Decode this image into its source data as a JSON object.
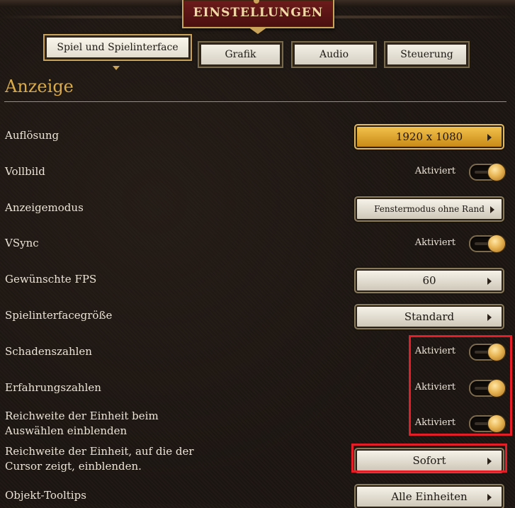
{
  "header": {
    "title": "EINSTELLUNGEN"
  },
  "tabs": [
    {
      "label": "Spiel und Spielinterface",
      "active": true
    },
    {
      "label": "Grafik"
    },
    {
      "label": "Audio"
    },
    {
      "label": "Steuerung"
    }
  ],
  "section": {
    "title": "Anzeige"
  },
  "rows": {
    "resolution": {
      "label": "Auflösung",
      "value": "1920 x 1080"
    },
    "fullscreen": {
      "label": "Vollbild",
      "status": "Aktiviert"
    },
    "display_mode": {
      "label": "Anzeigemodus",
      "value": "Fenstermodus ohne Rand"
    },
    "vsync": {
      "label": "VSync",
      "status": "Aktiviert"
    },
    "fps": {
      "label": "Gewünschte FPS",
      "value": "60"
    },
    "ui_size": {
      "label": "Spielinterfacegröße",
      "value": "Standard"
    },
    "damage_numbers": {
      "label": "Schadenszahlen",
      "status": "Aktiviert"
    },
    "xp_numbers": {
      "label": "Erfahrungszahlen",
      "status": "Aktiviert"
    },
    "unit_range_select": {
      "label_line1": "Reichweite der Einheit beim",
      "label_line2": "Auswählen einblenden",
      "status": "Aktiviert"
    },
    "unit_range_cursor": {
      "label_line1": "Reichweite der Einheit, auf die der",
      "label_line2": "Cursor zeigt, einblenden.",
      "value": "Sofort"
    },
    "object_tooltips": {
      "label": "Objekt-Tooltips",
      "value": "Alle Einheiten"
    }
  },
  "colors": {
    "accent_gold": "#d9ab4a",
    "highlight_red": "#e41e26",
    "banner_red": "#6d1b1b"
  }
}
